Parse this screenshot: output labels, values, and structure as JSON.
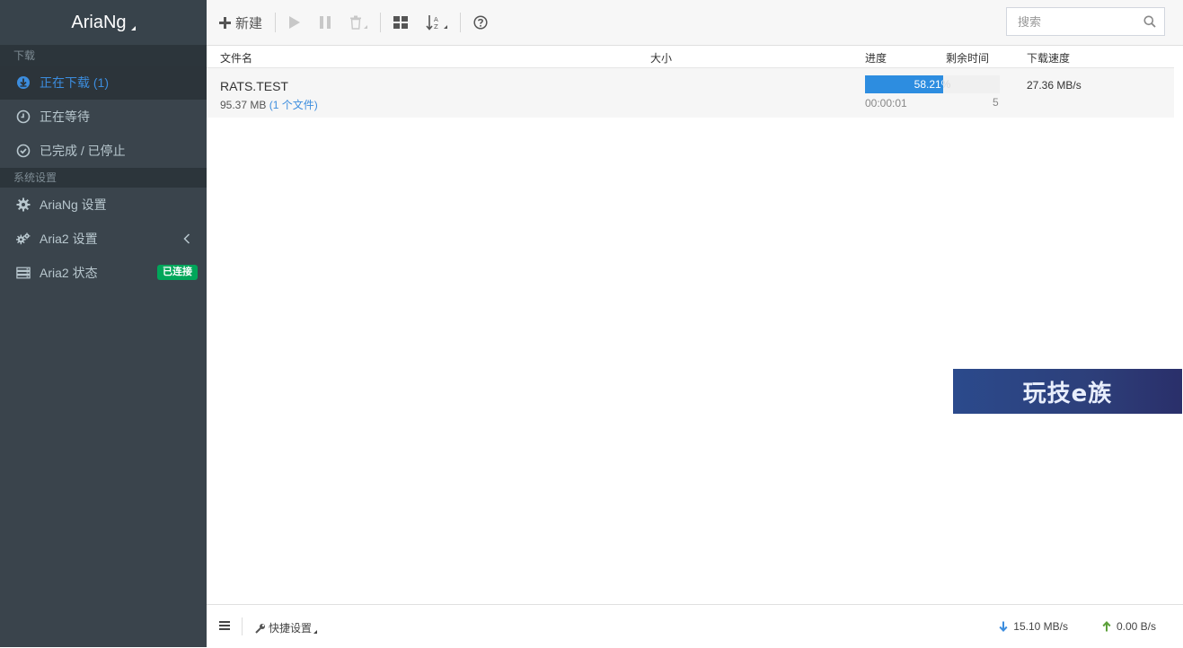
{
  "app": {
    "title": "AriaNg"
  },
  "sidebar": {
    "download_header": "下载",
    "downloading": "正在下载 (1)",
    "waiting": "正在等待",
    "stopped": "已完成 / 已停止",
    "settings_header": "系统设置",
    "ariang_settings": "AriaNg 设置",
    "aria2_settings": "Aria2 设置",
    "aria2_status": "Aria2 状态",
    "status_badge": "已连接"
  },
  "toolbar": {
    "new_label": "新建",
    "search_placeholder": "搜索"
  },
  "table": {
    "headers": {
      "name": "文件名",
      "size": "大小",
      "progress": "进度",
      "remaining": "剩余时间",
      "speed": "下载速度"
    },
    "rows": [
      {
        "name": "RATS.TEST",
        "size": "95.37 MB",
        "files": "(1 个文件)",
        "progress_text": "58.21%",
        "progress_value": 58.21,
        "remaining": "00:00:01",
        "connections": "5",
        "speed": "27.36 MB/s"
      }
    ]
  },
  "watermark": {
    "text": "玩技e族"
  },
  "footer": {
    "quick_settings": "快捷设置",
    "download_speed": "15.10 MB/s",
    "upload_speed": "0.00 B/s"
  },
  "colors": {
    "sidebar_bg": "#3a444c",
    "active_text": "#3c8dde",
    "progress_fill": "#2d8de0",
    "badge_green": "#00a65a",
    "down_arrow": "#3c8dde",
    "up_arrow": "#5ca03a"
  }
}
